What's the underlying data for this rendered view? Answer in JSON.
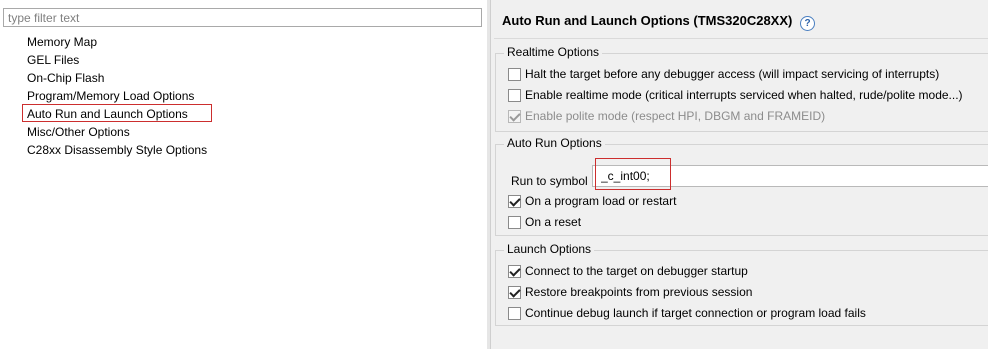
{
  "filter": {
    "placeholder": "type filter text",
    "value": ""
  },
  "tree": {
    "items": [
      {
        "label": "Memory Map"
      },
      {
        "label": "GEL Files"
      },
      {
        "label": "On-Chip Flash"
      },
      {
        "label": "Program/Memory Load Options"
      },
      {
        "label": "Auto Run and Launch Options"
      },
      {
        "label": "Misc/Other Options"
      },
      {
        "label": "C28xx Disassembly Style Options"
      }
    ],
    "selected": "Auto Run and Launch Options"
  },
  "page": {
    "title": "Auto Run and Launch Options (TMS320C28XX)",
    "help_icon": "question-circle-icon",
    "help_glyph": "?"
  },
  "realtime": {
    "legend": "Realtime Options",
    "halt": {
      "label": "Halt the target before any debugger access (will impact servicing of interrupts)",
      "checked": false
    },
    "realtime_mode": {
      "label": "Enable realtime mode (critical interrupts serviced when halted, rude/polite mode...)",
      "checked": false
    },
    "polite": {
      "label": "Enable polite mode (respect HPI, DBGM and FRAMEID)",
      "checked": true,
      "enabled": false
    }
  },
  "autorun": {
    "legend": "Auto Run Options",
    "symbol_label": "Run to symbol",
    "symbol_value": "_c_int00;",
    "on_load": {
      "label": "On a program load or restart",
      "checked": true
    },
    "on_reset": {
      "label": "On a reset",
      "checked": false
    }
  },
  "launch": {
    "legend": "Launch Options",
    "connect": {
      "label": "Connect to the target on debugger startup",
      "checked": true
    },
    "restore": {
      "label": "Restore breakpoints from previous session",
      "checked": true
    },
    "continue": {
      "label": "Continue debug launch if target connection or program load fails",
      "checked": false
    }
  },
  "colors": {
    "highlight": "#cc2e2e",
    "panel_bg": "#f0f0f0",
    "disabled_text": "#8c8c8c"
  }
}
